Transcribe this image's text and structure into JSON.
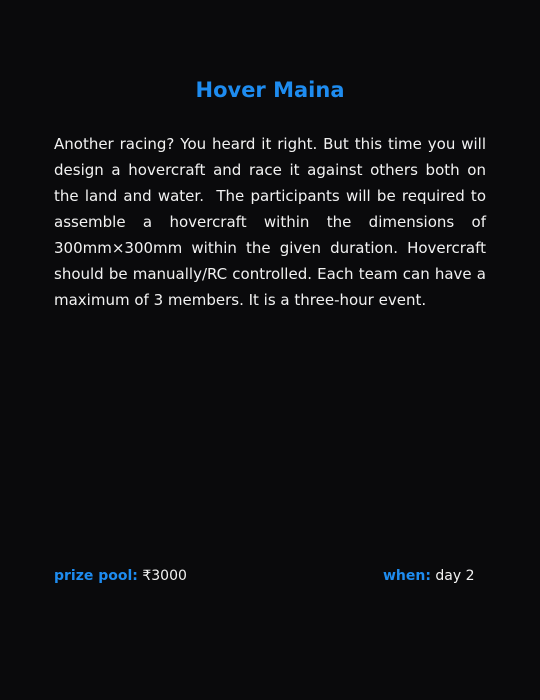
{
  "event": {
    "title": "Hover Maina",
    "description": "Another racing? You heard it right. But this time you will design a hovercraft and race it against others both on the land and water.  The participants will be required to assemble a hovercraft within the dimensions of 300mm×300mm within the given duration. Hovercraft should be manually/RC controlled. Each team can have a maximum of 3 members. It is a three-hour event.",
    "prize_pool": {
      "label": "prize pool:",
      "value": "₹3000"
    },
    "when": {
      "label": "when:",
      "value": "day 2"
    }
  },
  "colors": {
    "background": "#0a0a0c",
    "accent": "#1e8cf0",
    "text": "#f2f2f2"
  }
}
